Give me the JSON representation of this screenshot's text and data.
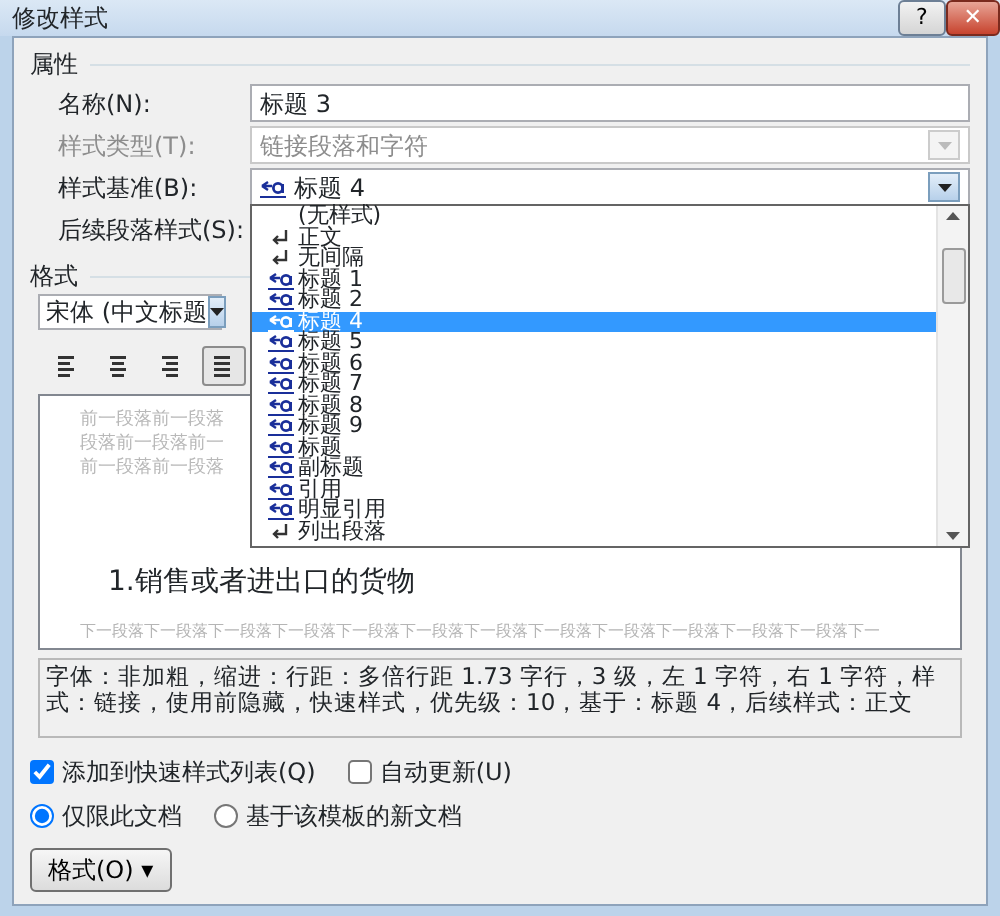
{
  "window": {
    "title": "修改样式",
    "buttons": [
      {
        "kind": "help",
        "label": "?"
      },
      {
        "kind": "close",
        "label": "✕"
      }
    ]
  },
  "properties": {
    "heading": "属性",
    "fields": [
      {
        "kind": "text",
        "label": "名称(N):",
        "value": "标题 3",
        "disabled": false
      },
      {
        "kind": "combo",
        "label": "样式类型(T):",
        "value": "链接段落和字符",
        "disabled": true,
        "expanded": false
      },
      {
        "kind": "combo",
        "label": "样式基准(B):",
        "value": "标题 4",
        "disabled": false,
        "expanded": true,
        "options": [
          {
            "label": "(无样式)",
            "kind": "none",
            "selected": false
          },
          {
            "label": "正文",
            "kind": "paragraph",
            "selected": false
          },
          {
            "label": "无间隔",
            "kind": "paragraph",
            "selected": false
          },
          {
            "label": "标题 1",
            "kind": "linked",
            "selected": false
          },
          {
            "label": "标题 2",
            "kind": "linked",
            "selected": false
          },
          {
            "label": "标题 4",
            "kind": "linked",
            "selected": true
          },
          {
            "label": "标题 5",
            "kind": "linked",
            "selected": false
          },
          {
            "label": "标题 6",
            "kind": "linked",
            "selected": false
          },
          {
            "label": "标题 7",
            "kind": "linked",
            "selected": false
          },
          {
            "label": "标题 8",
            "kind": "linked",
            "selected": false
          },
          {
            "label": "标题 9",
            "kind": "linked",
            "selected": false
          },
          {
            "label": "标题",
            "kind": "linked",
            "selected": false
          },
          {
            "label": "副标题",
            "kind": "linked",
            "selected": false
          },
          {
            "label": "引用",
            "kind": "linked",
            "selected": false
          },
          {
            "label": "明显引用",
            "kind": "linked",
            "selected": false
          },
          {
            "label": "列出段落",
            "kind": "paragraph",
            "selected": false
          }
        ]
      },
      {
        "kind": "label",
        "label": "后续段落样式(S):"
      }
    ]
  },
  "format": {
    "heading": "格式",
    "font": "宋体 (中文标题",
    "align_buttons": [
      {
        "kind": "left",
        "selected": false
      },
      {
        "kind": "center",
        "selected": false
      },
      {
        "kind": "right",
        "selected": false
      },
      {
        "kind": "justify",
        "selected": true
      }
    ]
  },
  "preview": {
    "previous_lines": [
      "前一段落前一段落",
      "段落前一段落前一",
      "前一段落前一段落"
    ],
    "sample": "1.销售或者进出口的货物",
    "next_line": "下一段落下一段落下一段落下一段落下一段落下一段落下一段落下一段落下一段落下一段落下一段落下一段落下一"
  },
  "description": "字体：非加粗，缩进：行距：多倍行距 1.73 字行，3 级，左 1 字符，右 1 字符，样式：链接，使用前隐藏，快速样式，优先级：10，基于：标题 4，后续样式：正文",
  "options": {
    "checkboxes": [
      {
        "label": "添加到快速样式列表(Q)",
        "checked": true
      },
      {
        "label": "自动更新(U)",
        "checked": false
      }
    ],
    "radios": [
      {
        "label": "仅限此文档",
        "selected": true
      },
      {
        "label": "基于该模板的新文档",
        "selected": false
      }
    ]
  },
  "format_button": {
    "label": "格式(O)",
    "caret": "▾"
  }
}
